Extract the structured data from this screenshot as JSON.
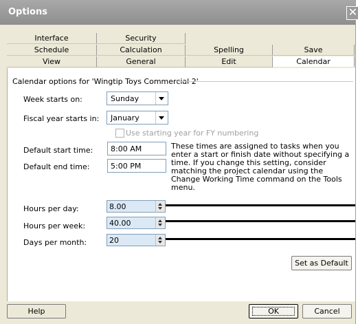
{
  "window": {
    "title": "Options",
    "close_glyph": "✕"
  },
  "tabs": {
    "row1": [
      "Interface",
      "Security"
    ],
    "row2": [
      "Schedule",
      "Calculation",
      "Spelling",
      "Save"
    ],
    "row3": [
      "View",
      "General",
      "Edit",
      "Calendar"
    ],
    "active": "Calendar"
  },
  "calendar": {
    "group_label": "Calendar options for 'Wingtip Toys Commercial 2'",
    "week_starts_label": "Week starts on:",
    "week_starts_value": "Sunday",
    "fiscal_label": "Fiscal year starts in:",
    "fiscal_value": "January",
    "fy_checkbox_label": "Use starting year for FY numbering",
    "fy_checkbox_checked": false,
    "start_time_label": "Default start time:",
    "start_time_value": "8:00 AM",
    "end_time_label": "Default end time:",
    "end_time_value": "5:00 PM",
    "note": "These times are assigned to tasks when you enter a start or finish date without specifying a time. If you change this setting, consider matching the project calendar using the Change Working Time command on the Tools menu.",
    "hours_day_label": "Hours per day:",
    "hours_day_value": "8.00",
    "hours_week_label": "Hours per week:",
    "hours_week_value": "40.00",
    "days_month_label": "Days per month:",
    "days_month_value": "20",
    "set_default_label": "Set as Default"
  },
  "footer": {
    "help": "Help",
    "ok": "OK",
    "cancel": "Cancel"
  },
  "colors": {
    "title_bar": "#9a9a9a",
    "dialog_bg": "#ece9d8",
    "spin_bg": "#dbe9f6"
  }
}
